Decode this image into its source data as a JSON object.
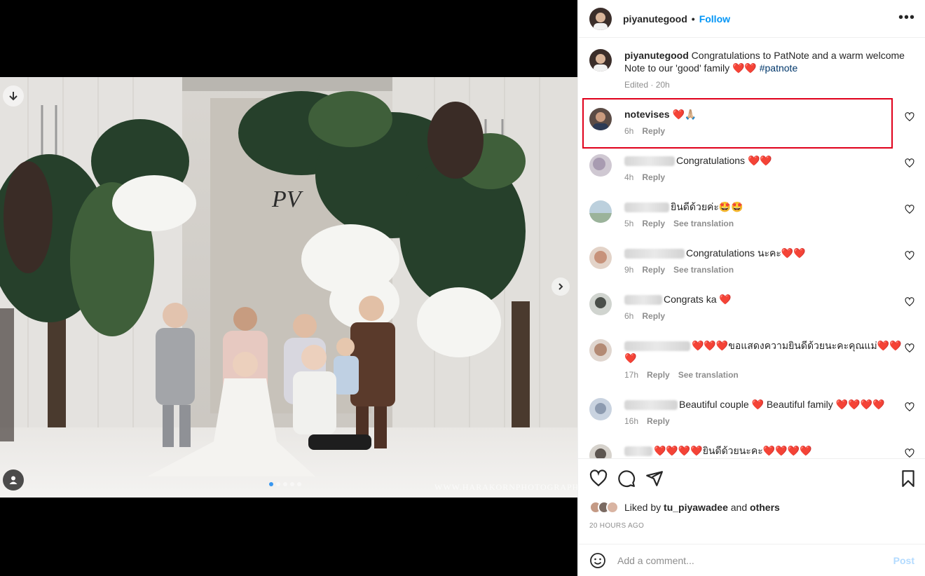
{
  "post": {
    "username": "piyanutegood",
    "follow_label": "Follow",
    "separator": "•",
    "more_icon": "more-horizontal-icon"
  },
  "media": {
    "watermark": "WWW.HARAKORNPHOTOGRAPHY.COM",
    "monogram": "PV",
    "carousel_count": 5,
    "carousel_active": 1
  },
  "caption": {
    "username": "piyanutegood",
    "text": "Congratulations to PatNote and a warm welcome Note to our 'good' family ❤️❤️",
    "hashtag": "#patnote",
    "edited": "Edited · 20h"
  },
  "comments": [
    {
      "username": "notevises",
      "text": "❤️🙏🏼",
      "time": "6h",
      "reply": "Reply",
      "translate": "",
      "blurred_name": false
    },
    {
      "username": "",
      "text": "Congratulations ❤️❤️",
      "time": "4h",
      "reply": "Reply",
      "translate": "",
      "blurred_name": true
    },
    {
      "username": "",
      "text": "ยินดีด้วยค่ะ🤩🤩",
      "time": "5h",
      "reply": "Reply",
      "translate": "See translation",
      "blurred_name": true
    },
    {
      "username": "",
      "text": "Congratulations นะคะ❤️❤️",
      "time": "9h",
      "reply": "Reply",
      "translate": "See translation",
      "blurred_name": true
    },
    {
      "username": "",
      "text": "Congrats ka ❤️",
      "time": "6h",
      "reply": "Reply",
      "translate": "",
      "blurred_name": true
    },
    {
      "username": "",
      "text": "❤️❤️❤️ขอแสดงความยินดีด้วยนะคะคุณแม่❤️❤️❤️",
      "time": "17h",
      "reply": "Reply",
      "translate": "See translation",
      "blurred_name": true
    },
    {
      "username": "",
      "text": "Beautiful couple ❤️ Beautiful family ❤️❤️❤️❤️",
      "time": "16h",
      "reply": "Reply",
      "translate": "",
      "blurred_name": true
    },
    {
      "username": "",
      "text": "❤️❤️❤️❤️ยินดีด้วยนะคะ❤️❤️❤️❤️",
      "time": "",
      "reply": "",
      "translate": "",
      "blurred_name": true
    }
  ],
  "actions": {
    "like_icon": "heart-icon",
    "comment_icon": "comment-icon",
    "share_icon": "share-icon",
    "save_icon": "bookmark-icon"
  },
  "likes": {
    "prefix": "Liked by",
    "user": "tu_piyawadee",
    "middle": "and",
    "others": "others"
  },
  "time_ago": "20 HOURS AGO",
  "add_comment": {
    "placeholder": "Add a comment...",
    "post_label": "Post"
  },
  "colors": {
    "accent": "#0095f6",
    "highlight_box": "#e0001b",
    "heart": "#e0245e"
  }
}
